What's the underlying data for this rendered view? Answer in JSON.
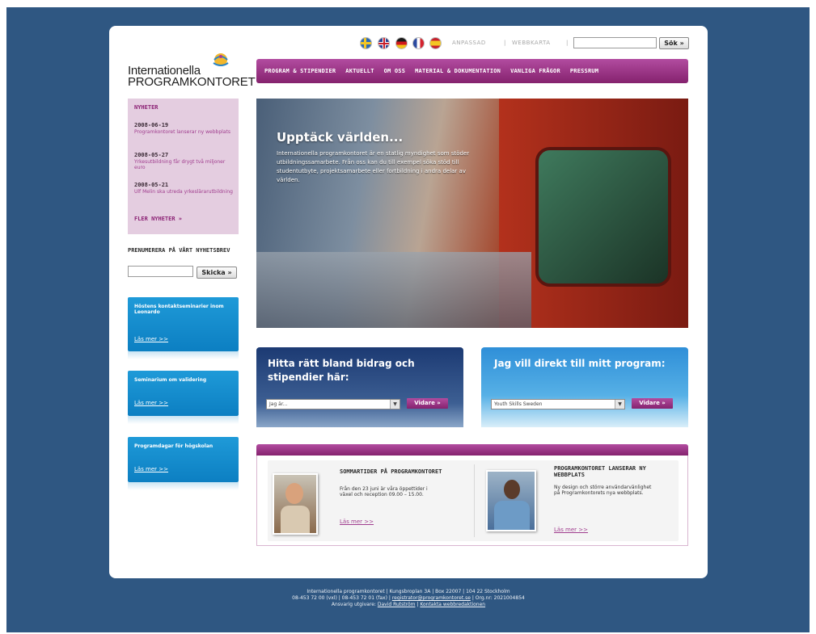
{
  "logo": {
    "line1": "Internationella",
    "line2": "PROGRAMKONTORET",
    "mark_icon": "globe-figure-logo-icon"
  },
  "top": {
    "flags": [
      {
        "name": "sweden-flag-icon",
        "colors": [
          "#2d6bb5",
          "#f3c623"
        ]
      },
      {
        "name": "uk-flag-icon",
        "colors": [
          "#2d3f8f",
          "#c8202c"
        ]
      },
      {
        "name": "germany-flag-icon",
        "colors": [
          "#1a1a1a",
          "#d1171c",
          "#f1c21b"
        ]
      },
      {
        "name": "france-flag-icon",
        "colors": [
          "#2b4aa0",
          "#ffffff",
          "#d3232e"
        ]
      },
      {
        "name": "spain-flag-icon",
        "colors": [
          "#c8202c",
          "#f3c623"
        ]
      }
    ],
    "links": [
      "ANPASSAD",
      "WEBBKARTA"
    ],
    "search_button": "Sök »"
  },
  "nav": [
    "PROGRAM & STIPENDIER",
    "AKTUELLT",
    "OM OSS",
    "MATERIAL & DOKUMENTATION",
    "VANLIGA FRÅGOR",
    "PRESSRUM"
  ],
  "news": {
    "heading": "NYHETER",
    "items": [
      {
        "date": "2008-06-19",
        "text": "Programkontoret lanserar ny webbplats"
      },
      {
        "date": "2008-05-27",
        "text": "Yrkesutbildning får drygt två miljoner euro"
      },
      {
        "date": "2008-05-21",
        "text": "Ulf Melin ska utreda yrkeslärarutbildning"
      }
    ],
    "more": "FLER NYHETER »"
  },
  "newsletter": {
    "heading": "PRENUMERERA PÅ VÅRT NYHETSBREV",
    "button": "Skicka »"
  },
  "side_boxes": [
    {
      "title": "Höstens kontaktseminarier inom Leonardo",
      "link": "Läs mer >>"
    },
    {
      "title": "Seminarium om validering",
      "link": "Läs mer >>"
    },
    {
      "title": "Programdagar för högskolan",
      "link": "Läs mer >>"
    }
  ],
  "hero": {
    "title": "Upptäck världen...",
    "text": "Internationella programkontoret är en statlig myndighet som stöder utbildningssamarbete. Från oss kan du till exempel söka stöd till studentutbyte, projektsamarbete eller fortbildning i andra delar av världen."
  },
  "finder": {
    "title": "Hitta rätt bland bidrag och stipendier här:",
    "select_value": "Jag är...",
    "button": "Vidare »"
  },
  "direct": {
    "title": "Jag vill direkt till mitt program:",
    "select_value": "Youth Skills Sweden",
    "button": "Vidare »"
  },
  "promos": [
    {
      "title": "SOMMARTIDER PÅ PROGRAMKONTORET",
      "text": "Från den 23 juni är våra öppettider i växel och reception 09.00 – 15.00.",
      "link": "Läs mer >>"
    },
    {
      "title": "PROGRAMKONTORET LANSERAR NY WEBBPLATS",
      "text": "Ny design och större användarvänlighet på Programkontorets nya webbplats.",
      "link": "Läs mer >>"
    }
  ],
  "footer": {
    "line1": "Internationella programkontoret | Kungsbroplan 3A | Box 22007 | 104 22 Stockholm",
    "line2_prefix": "08-453 72 00 (vxl) | 08-453 72 01 (fax) |",
    "email": "registrator@programkontoret.se",
    "line2_suffix": "| Org.nr: 2021004854",
    "line3_prefix": "Ansvarig utgivare:",
    "publisher": "David Rutström",
    "contact": "Kontakta webbredaktionen"
  }
}
